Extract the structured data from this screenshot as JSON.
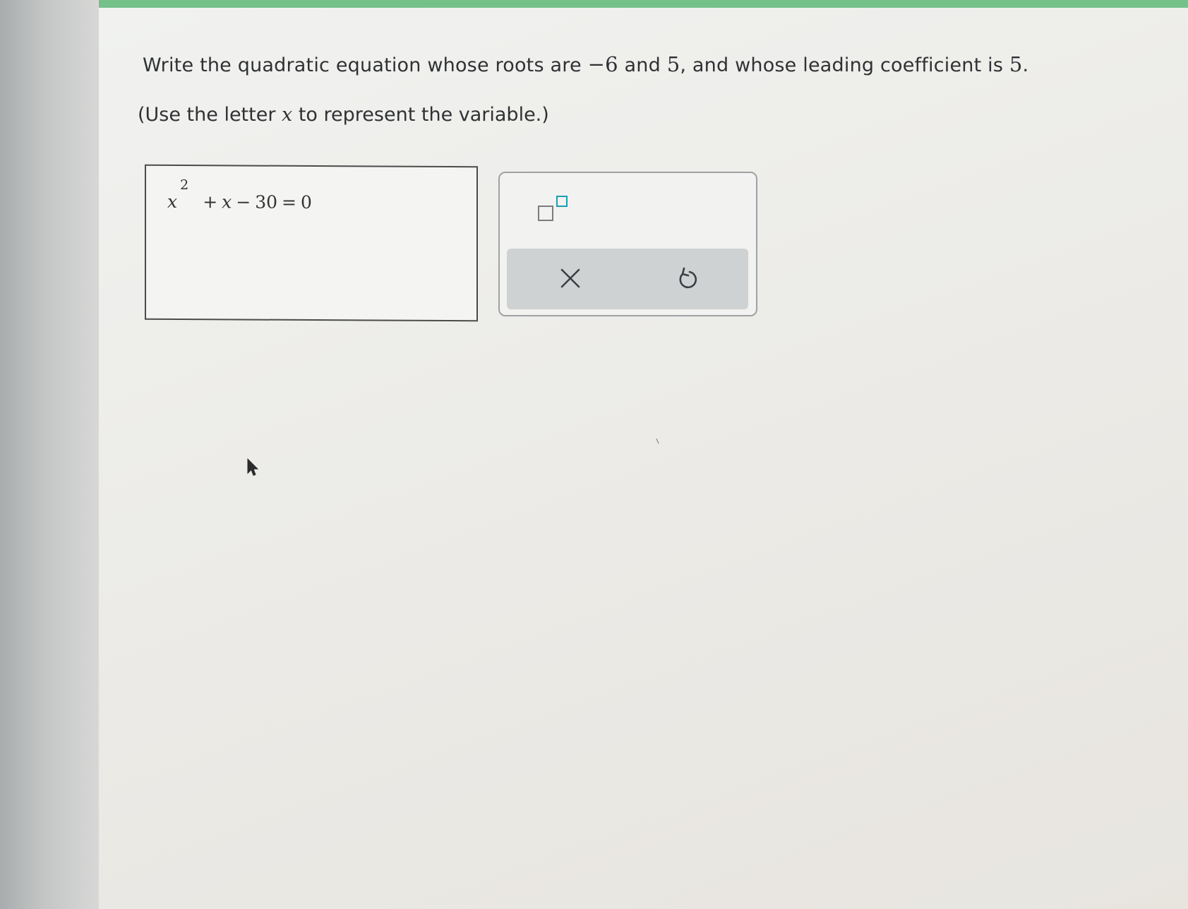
{
  "question": {
    "prefix": "Write the quadratic equation whose roots are ",
    "root1": "−6",
    "and1": " and ",
    "root2": "5",
    "middle": ", and whose leading coefficient is ",
    "coefficient": "5",
    "suffix": "."
  },
  "instruction": {
    "prefix": "(Use the letter ",
    "variable": "x",
    "suffix": " to represent the variable.)"
  },
  "answer": {
    "var1": "x",
    "exponent": "2",
    "plus": "+",
    "var2": "x",
    "minus": "−",
    "constant": "30",
    "equals": "=",
    "rhs": "0"
  },
  "toolbox": {
    "exponent_icon": "exponent-template-icon",
    "clear_icon": "close-icon",
    "reset_icon": "undo-icon",
    "accent_color": "#1b9db3"
  },
  "theme": {
    "top_bar_color": "#74c18a"
  }
}
